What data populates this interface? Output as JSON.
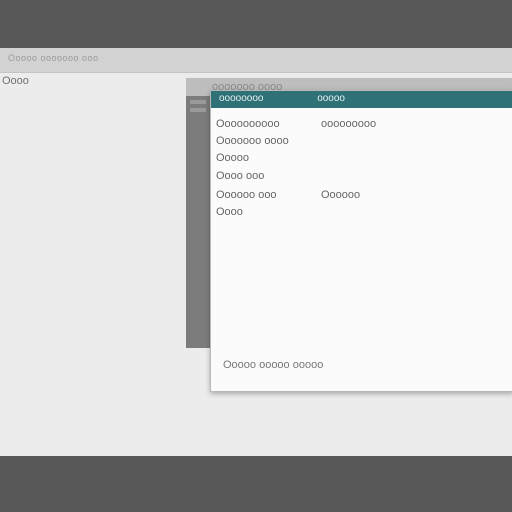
{
  "window": {
    "title": "Ooooo ooooooo ooo",
    "left_label": "Oooo"
  },
  "background_panel": {
    "title": "ooooooo oooo"
  },
  "dialog": {
    "title": "oooooooo",
    "header_right": "ooooo",
    "rows": [
      {
        "key": "Oooooooooo",
        "value": "ooooooooo"
      },
      {
        "key": "Ooooooo oooo",
        "value": ""
      },
      {
        "key": "Ooooo",
        "value": ""
      },
      {
        "key": "Oooo ooo",
        "value": ""
      },
      {
        "key": "Oooooo ooo",
        "value": "Oooooo"
      },
      {
        "key": "Oooo",
        "value": ""
      }
    ],
    "footer_text": "Ooooo ooooo ooooo"
  }
}
